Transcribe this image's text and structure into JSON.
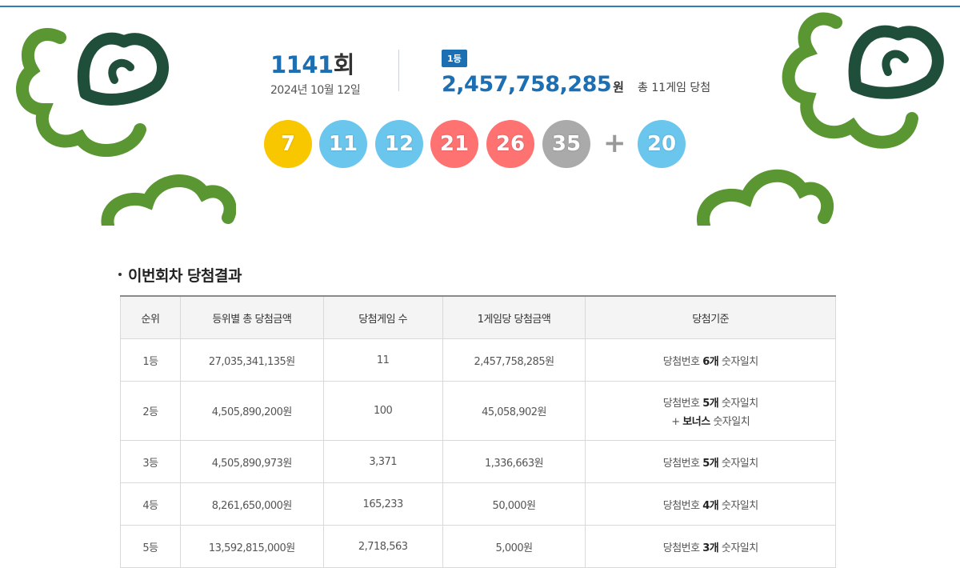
{
  "draw": {
    "number": "1141",
    "unit": "회",
    "date": "2024년 10월 12일"
  },
  "prize": {
    "badge": "1등",
    "amount": "2,457,758,285",
    "currency": "원",
    "winners_text": "총 11게임 당첨"
  },
  "balls": [
    {
      "value": "7",
      "color": "#f9c700"
    },
    {
      "value": "11",
      "color": "#6bc6ee"
    },
    {
      "value": "12",
      "color": "#6bc6ee"
    },
    {
      "value": "21",
      "color": "#ff7272"
    },
    {
      "value": "26",
      "color": "#ff7272"
    },
    {
      "value": "35",
      "color": "#aaaaaa"
    }
  ],
  "plus_sign": "+",
  "bonus_ball": {
    "value": "20",
    "color": "#6bc6ee"
  },
  "section": {
    "title": "이번회차 당첨결과"
  },
  "table": {
    "headers": [
      "순위",
      "등위별 총 당첨금액",
      "당첨게임 수",
      "1게임당 당첨금액",
      "당첨기준"
    ],
    "rows": [
      {
        "rank": "1등",
        "total": "27,035,341,135원",
        "games": "11",
        "per_game": "2,457,758,285원",
        "criteria_prefix": "당첨번호 ",
        "criteria_count": "6개",
        "criteria_suffix": " 숫자일치",
        "criteria_line2_prefix": "",
        "criteria_line2_bold": "",
        "criteria_line2_suffix": ""
      },
      {
        "rank": "2등",
        "total": "4,505,890,200원",
        "games": "100",
        "per_game": "45,058,902원",
        "criteria_prefix": "당첨번호 ",
        "criteria_count": "5개",
        "criteria_suffix": " 숫자일치",
        "criteria_line2_prefix": "+ ",
        "criteria_line2_bold": "보너스",
        "criteria_line2_suffix": " 숫자일치"
      },
      {
        "rank": "3등",
        "total": "4,505,890,973원",
        "games": "3,371",
        "per_game": "1,336,663원",
        "criteria_prefix": "당첨번호 ",
        "criteria_count": "5개",
        "criteria_suffix": " 숫자일치",
        "criteria_line2_prefix": "",
        "criteria_line2_bold": "",
        "criteria_line2_suffix": ""
      },
      {
        "rank": "4등",
        "total": "8,261,650,000원",
        "games": "165,233",
        "per_game": "50,000원",
        "criteria_prefix": "당첨번호 ",
        "criteria_count": "4개",
        "criteria_suffix": " 숫자일치",
        "criteria_line2_prefix": "",
        "criteria_line2_bold": "",
        "criteria_line2_suffix": ""
      },
      {
        "rank": "5등",
        "total": "13,592,815,000원",
        "games": "2,718,563",
        "per_game": "5,000원",
        "criteria_prefix": "당첨번호 ",
        "criteria_count": "3개",
        "criteria_suffix": " 숫자일치",
        "criteria_line2_prefix": "",
        "criteria_line2_bold": "",
        "criteria_line2_suffix": ""
      }
    ]
  },
  "colors": {
    "accent_blue": "#1c6fb3",
    "clover_green": "#5a9632",
    "clover_dark": "#1f4f3a"
  }
}
